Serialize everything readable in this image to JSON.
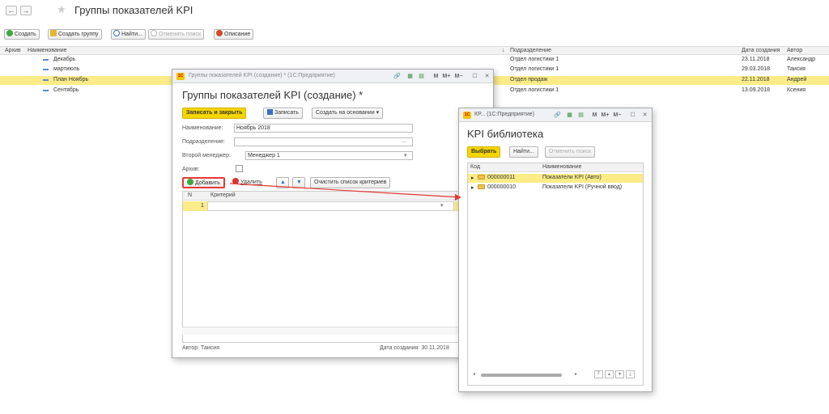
{
  "main": {
    "title": "Группы показателей KPI",
    "nav_back": "←",
    "nav_forward": "→",
    "toolbar": {
      "create": "Создать",
      "create_group": "Создать группу",
      "find": "Найти...",
      "cancel_search": "Отменить поиск",
      "description": "Описание"
    },
    "columns": {
      "archive": "Архив",
      "name": "Наименование",
      "sort_arrow": "↓",
      "department": "Подразделение",
      "created": "Дата создания",
      "author": "Автор"
    },
    "rows": [
      {
        "name": "Декабрь",
        "department": "Отдел логистики 1",
        "date": "23.11.2018",
        "author": "Александр"
      },
      {
        "name": "мартиюль",
        "department": "Отдел логистики 1",
        "date": "29.03.2018",
        "author": "Таисия"
      },
      {
        "name": "План Ноябрь",
        "department": "Отдел продаж",
        "date": "22.11.2018",
        "author": "Андрей"
      },
      {
        "name": "Сентябрь",
        "department": "Отдел логистики 1",
        "date": "13.09.2018",
        "author": "Ксения"
      }
    ]
  },
  "dialog1": {
    "window_title": "Группы показателей KPI (создание) * (1С:Предприятие)",
    "title": "Группы показателей KPI (создание) *",
    "save_close": "Записать и закрыть",
    "save": "Записать",
    "create_based": "Создать на основании",
    "name_label": "Наименование:",
    "name_value": "Ноябрь 2018",
    "dept_label": "Подразделение:",
    "dept_value": "",
    "manager_label": "Второй менеджер:",
    "manager_value": "Менеджер 1",
    "archive_label": "Архив:",
    "add": "Добавить",
    "delete": "Удалить",
    "clear": "Очистить список критериев",
    "col_n": "N",
    "col_criterion": "Критерий",
    "row_n": "1",
    "author": "Автор: Таисия",
    "created": "Дата создания: 30.11.2018"
  },
  "dialog2": {
    "window_title": "КР... (1С:Предприятие)",
    "title": "KPI библиотека",
    "select": "Выбрать",
    "find": "Найти...",
    "cancel_search": "Отменить поиск",
    "col_code": "Код",
    "col_name": "Наименование",
    "rows": [
      {
        "code": "000000011",
        "name": "Показатели KPI (Авто)"
      },
      {
        "code": "000000010",
        "name": "Показатели KPI (Ручной ввод)"
      }
    ]
  },
  "colors": {
    "accent_yellow": "#f5d500",
    "selection": "#fbec88",
    "arrow_red": "#e53935"
  }
}
